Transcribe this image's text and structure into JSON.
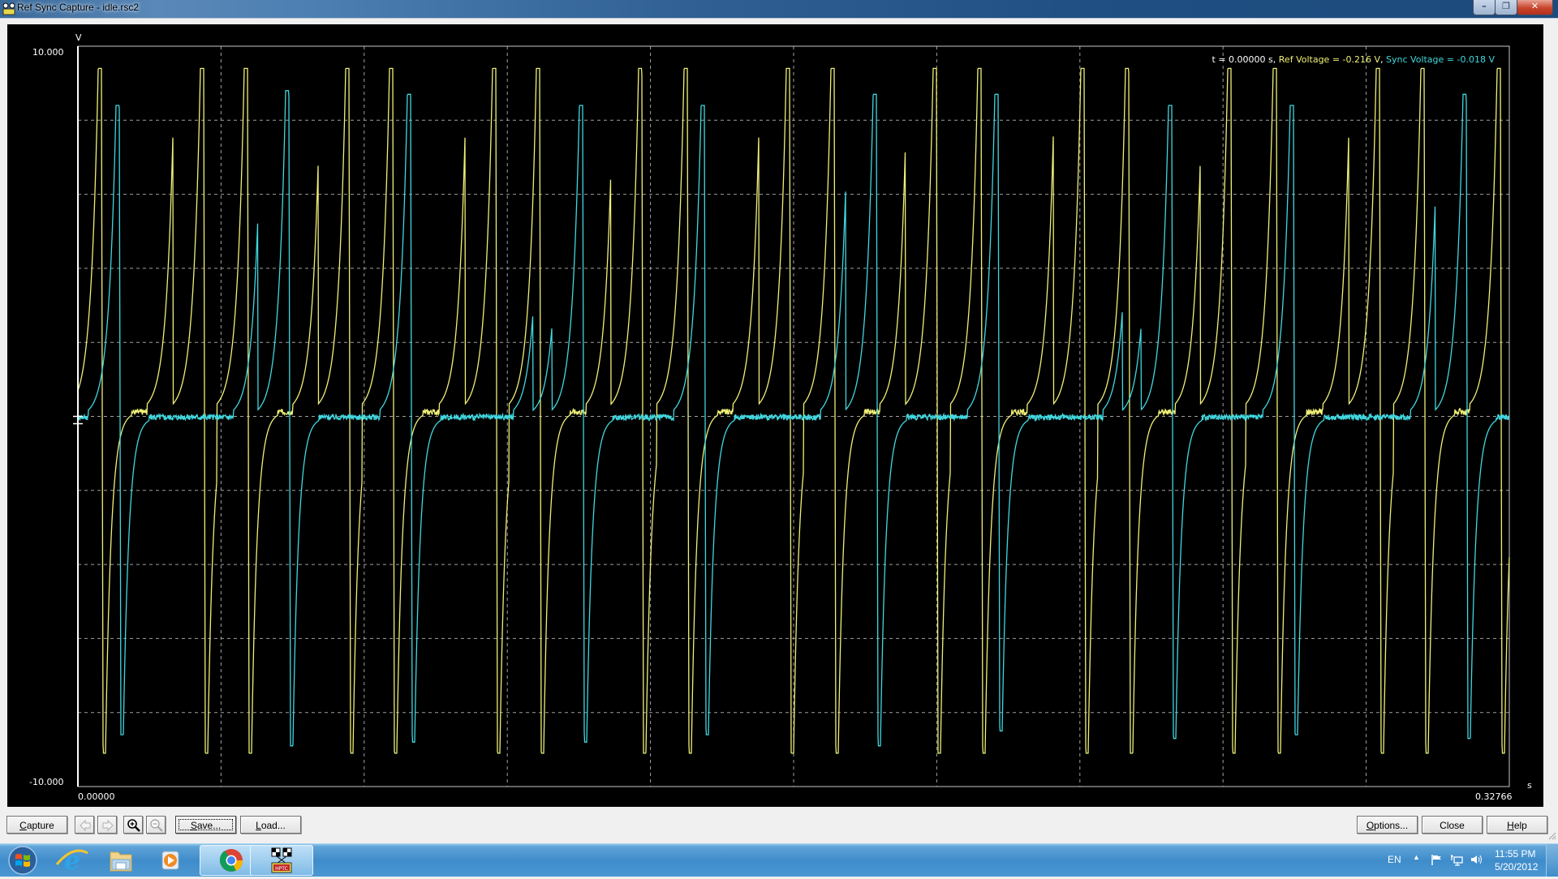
{
  "window": {
    "title": "Ref Sync Capture - idle.rsc2",
    "controls": {
      "minimize": "minimize",
      "maximize": "restore",
      "close": "close"
    }
  },
  "readout": {
    "time": "t = 0.00000 s",
    "sep1": ", ",
    "ref": "Ref Voltage = -0.216 V",
    "sep2": ", ",
    "sync": "Sync Voltage = -0.018 V"
  },
  "toolbar": {
    "capture": "Capture",
    "capture_mnemonic": "C",
    "capture_rest": "apture",
    "scroll_left_icon": "arrow-left-icon",
    "scroll_right_icon": "arrow-right-icon",
    "zoom_in_icon": "zoom-in-icon",
    "zoom_out_icon": "zoom-out-icon",
    "save_mnemonic": "S",
    "save_rest": "ave...",
    "load_mnemonic": "L",
    "load_rest": "oad...",
    "options_mnemonic": "O",
    "options_rest": "ptions...",
    "close": "Close",
    "help_mnemonic": "H",
    "help_rest": "elp"
  },
  "taskbar": {
    "items": [
      {
        "name": "start-button",
        "icon": "windows-logo-icon"
      },
      {
        "name": "internet-explorer",
        "icon": "ie-icon"
      },
      {
        "name": "windows-explorer",
        "icon": "folder-icon"
      },
      {
        "name": "media-player",
        "icon": "media-player-icon"
      },
      {
        "name": "chrome",
        "icon": "chrome-icon"
      },
      {
        "name": "hptuners",
        "icon": "checkered-flags-icon",
        "badge": "HPTC"
      }
    ],
    "language": "EN",
    "time": "11:55 PM",
    "date": "5/20/2012"
  },
  "colors": {
    "ref": "#f0f078",
    "sync": "#40d8e0",
    "grid": "#a0a0a0",
    "axis": "#c8c8c8"
  },
  "chart_data": {
    "type": "line",
    "title": "",
    "xlabel": "s",
    "ylabel": "V",
    "xlim": [
      0.0,
      0.32766
    ],
    "ylim": [
      -10.0,
      10.0
    ],
    "x_tick_labels": [
      "0.00000",
      "0.32766"
    ],
    "y_tick_labels": [
      "10.000",
      "-10.000"
    ],
    "grid": {
      "x_divisions": 10,
      "y_divisions": 10,
      "style": "dashed"
    },
    "cursor_t": 0.0,
    "series": [
      {
        "name": "Ref Voltage",
        "color": "#f0f078",
        "baseline": 0.12,
        "peak": 9.4,
        "trough": -9.1,
        "pulse_times": [
          0.00502,
          0.02248,
          0.02842,
          0.03845,
          0.05591,
          0.06167,
          0.0717,
          0.08935,
          0.09529,
          0.10532,
          0.12297,
          0.12872,
          0.13913,
          0.15659,
          0.16253,
          0.17275,
          0.19021,
          0.19615,
          0.20637,
          0.22401,
          0.22996,
          0.24017,
          0.25782,
          0.26358,
          0.27398,
          0.29163,
          0.29757,
          0.30779,
          0.32525
        ]
      },
      {
        "name": "Sync Voltage",
        "color": "#40d8e0",
        "baseline": -0.02,
        "pulse_times": [
          0.0091,
          0.04235,
          0.04792,
          0.07579,
          0.10643,
          0.11089,
          0.11517,
          0.14303,
          0.17665,
          0.18241,
          0.21027,
          0.24129,
          0.24575,
          0.25002,
          0.27788,
          0.31169,
          0.31744
        ],
        "peaks": [
          8.4,
          8.6,
          8.8,
          8.7,
          8.7,
          8.1,
          8.4,
          8.4,
          8.5,
          8.7,
          8.7,
          8.6,
          8.1,
          8.4,
          8.4,
          8.4,
          8.7
        ],
        "troughs": [
          -8.6,
          -8.7,
          -8.9,
          -8.8,
          -8.4,
          -8.5,
          -8.8,
          -8.6,
          -8.8,
          -8.9,
          -8.5,
          -8.8,
          -8.4,
          -8.7,
          -8.6,
          -8.8,
          -8.7
        ]
      }
    ]
  }
}
